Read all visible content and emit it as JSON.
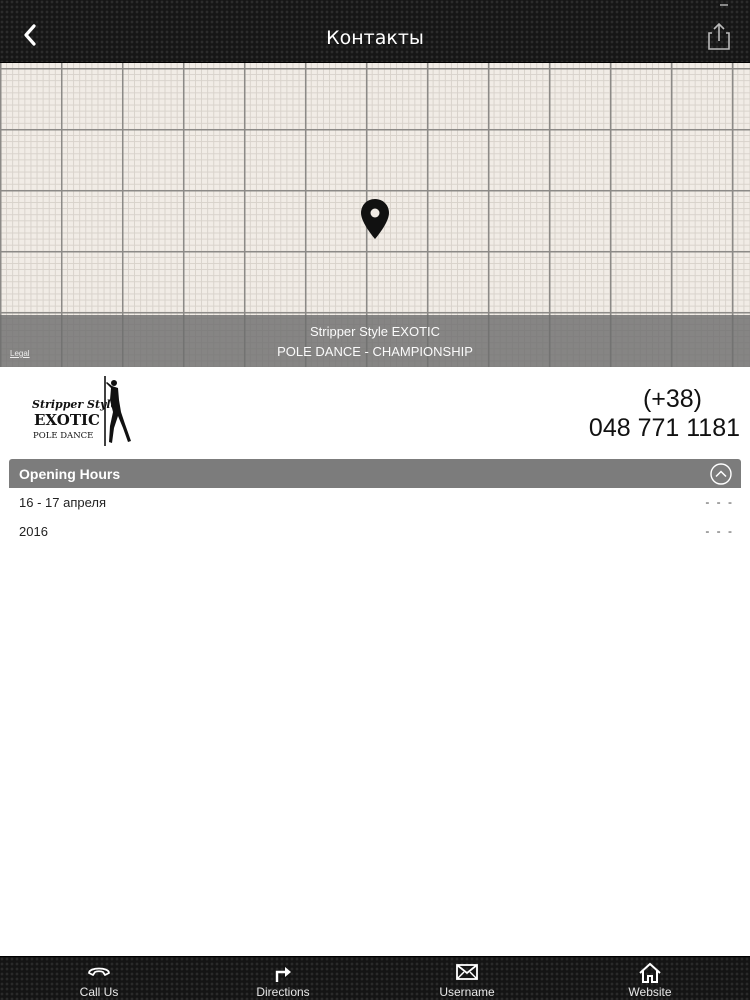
{
  "header": {
    "title": "Контакты",
    "back_icon": "chevron-left-icon",
    "share_icon": "share-icon"
  },
  "map": {
    "pin_icon": "map-pin-icon",
    "caption_line1": "Stripper Style EXOTIC",
    "caption_line2": "POLE DANCE - CHAMPIONSHIP",
    "legal_label": "Legal"
  },
  "business": {
    "logo": {
      "line1": "Stripper Style",
      "line2": "EXOTIC",
      "line3": "POLE DANCE"
    },
    "phone_line1": "(+38)",
    "phone_line2": "048 771 1181"
  },
  "opening_hours": {
    "title": "Opening Hours",
    "collapse_icon": "chevron-up-circle-icon",
    "rows": [
      {
        "label": "16 - 17 апреля",
        "value": "- - -"
      },
      {
        "label": "2016",
        "value": "- - -"
      }
    ]
  },
  "tabbar": {
    "tabs": [
      {
        "label": "Call Us",
        "icon": "phone-icon"
      },
      {
        "label": "Directions",
        "icon": "directions-icon"
      },
      {
        "label": "Username",
        "icon": "envelope-icon"
      },
      {
        "label": "Website",
        "icon": "home-icon"
      }
    ]
  },
  "colors": {
    "header_bg": "#161616",
    "map_bg": "#f1ece6",
    "hours_bar": "#7c7c7c"
  }
}
